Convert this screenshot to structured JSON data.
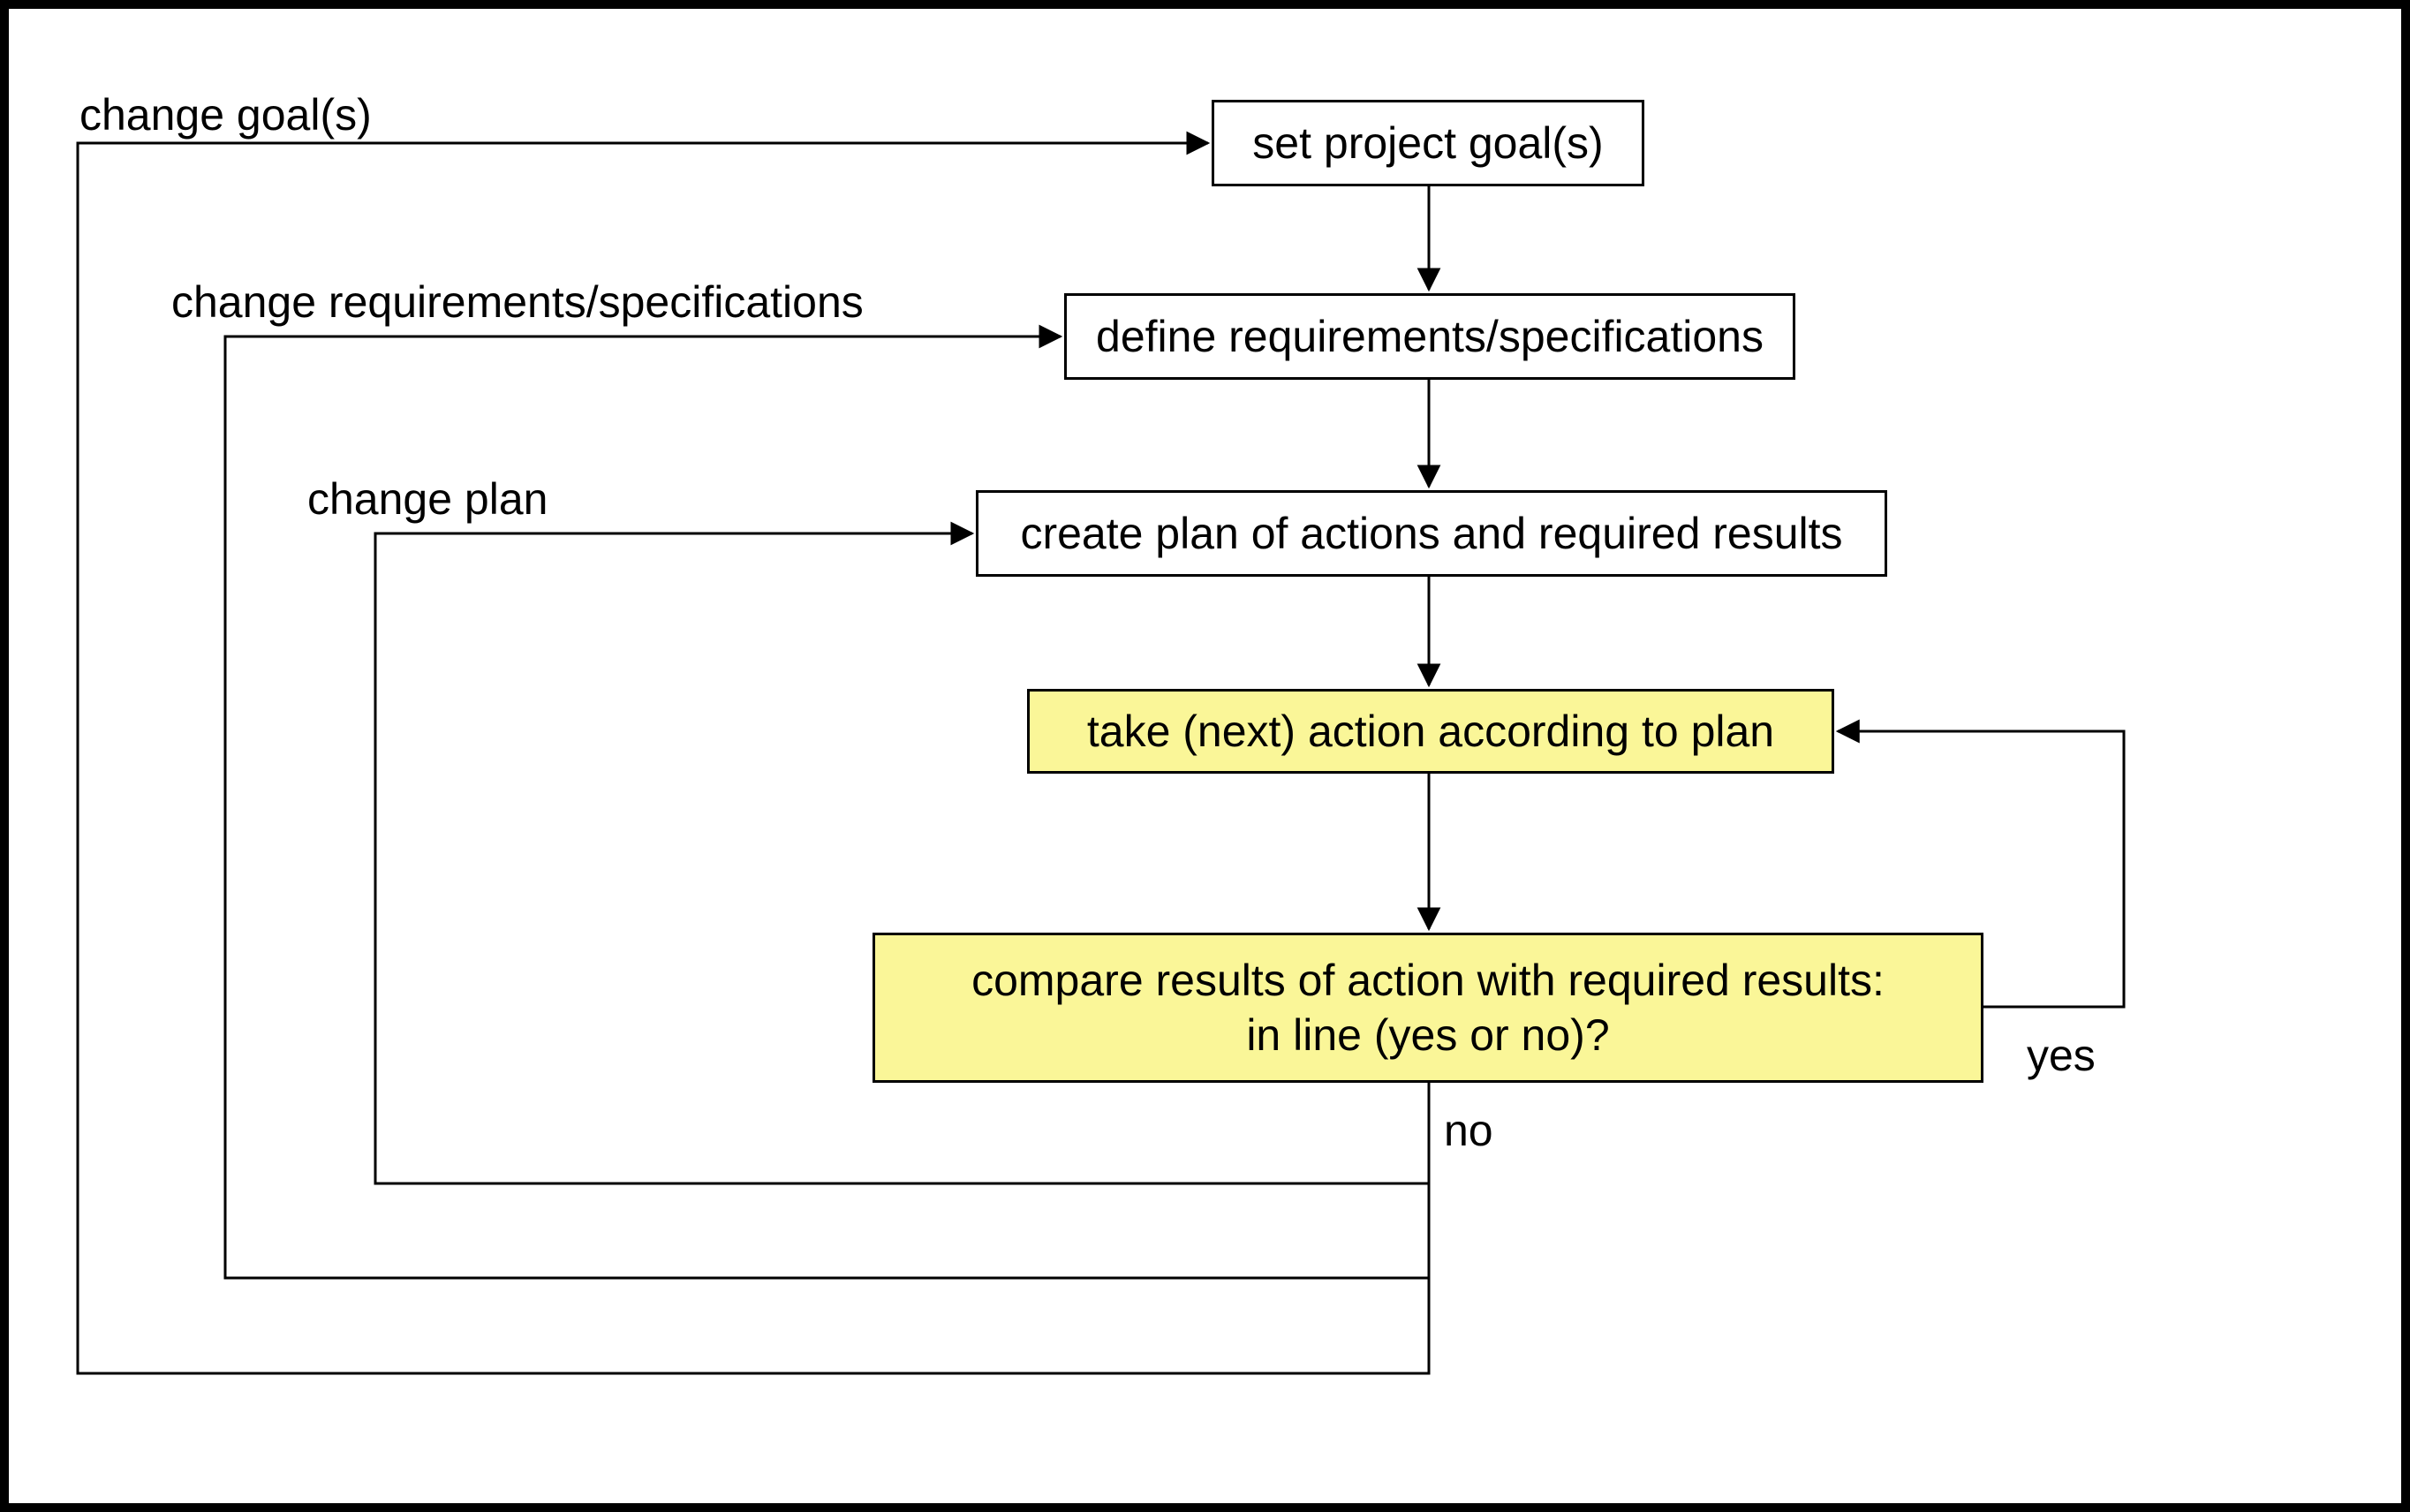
{
  "nodes": {
    "set_goals": "set project goal(s)",
    "define_req": "define requirements/specifications",
    "create_plan": "create plan of actions and required results",
    "take_action": "take (next) action according to plan",
    "compare": "compare results of action with required results:\nin line (yes or no)?"
  },
  "labels": {
    "change_goals": "change goal(s)",
    "change_req": "change requirements/specifications",
    "change_plan": "change plan",
    "yes": "yes",
    "no": "no"
  }
}
